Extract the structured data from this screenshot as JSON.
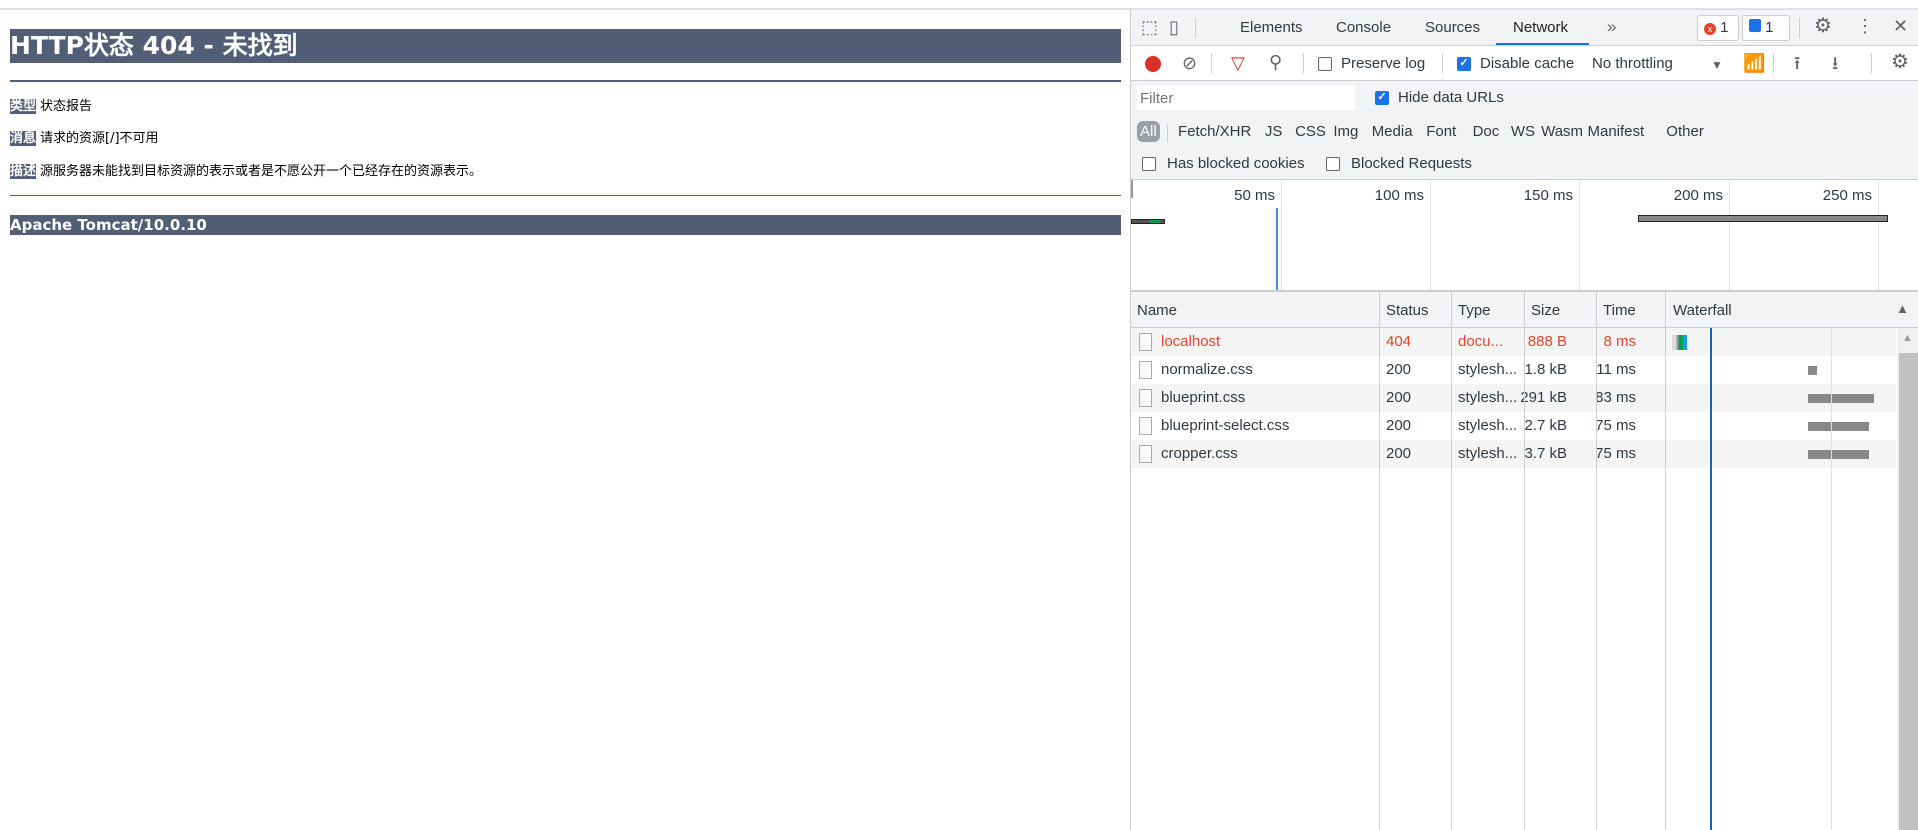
{
  "page": {
    "title": "HTTP状态 404 - 未找到",
    "fields": [
      {
        "label": "类型",
        "value": "状态报告"
      },
      {
        "label": "消息",
        "value": "请求的资源[/]不可用"
      },
      {
        "label": "描述",
        "value": "源服务器未能找到目标资源的表示或者是不愿公开一个已经存在的资源表示。"
      }
    ],
    "footer": "Apache Tomcat/10.0.10"
  },
  "devtools": {
    "tabs": [
      "Elements",
      "Console",
      "Sources",
      "Network"
    ],
    "active_tab": "Network",
    "more": "»",
    "error_count": "1",
    "message_count": "1",
    "toolbar": {
      "preserve_log": "Preserve log",
      "preserve_log_checked": false,
      "disable_cache": "Disable cache",
      "disable_cache_checked": true,
      "throttling": "No throttling"
    },
    "filter": {
      "placeholder": "Filter",
      "value": "",
      "hide_data_urls": "Hide data URLs",
      "hide_data_urls_checked": true
    },
    "types": [
      "All",
      "Fetch/XHR",
      "JS",
      "CSS",
      "Img",
      "Media",
      "Font",
      "Doc",
      "WS",
      "Wasm",
      "Manifest",
      "Other"
    ],
    "blocked": {
      "cookies": "Has blocked cookies",
      "requests": "Blocked Requests"
    },
    "overview_ticks": [
      "50 ms",
      "100 ms",
      "150 ms",
      "200 ms",
      "250 ms"
    ],
    "columns": [
      "Name",
      "Status",
      "Type",
      "Size",
      "Time",
      "Waterfall"
    ],
    "requests": [
      {
        "name": "localhost",
        "status": "404",
        "type": "docu...",
        "size": "888 B",
        "time": "8 ms",
        "error": true
      },
      {
        "name": "normalize.css",
        "status": "200",
        "type": "stylesh...",
        "size": "1.8 kB",
        "time": "11 ms"
      },
      {
        "name": "blueprint.css",
        "status": "200",
        "type": "stylesh...",
        "size": "291 kB",
        "time": "83 ms"
      },
      {
        "name": "blueprint-select.css",
        "status": "200",
        "type": "stylesh...",
        "size": "2.7 kB",
        "time": "75 ms"
      },
      {
        "name": "cropper.css",
        "status": "200",
        "type": "stylesh...",
        "size": "3.7 kB",
        "time": "75 ms"
      }
    ],
    "colors": {
      "accent": "#1a73e8",
      "error": "#e8432e",
      "tomcat": "#525D76"
    }
  }
}
